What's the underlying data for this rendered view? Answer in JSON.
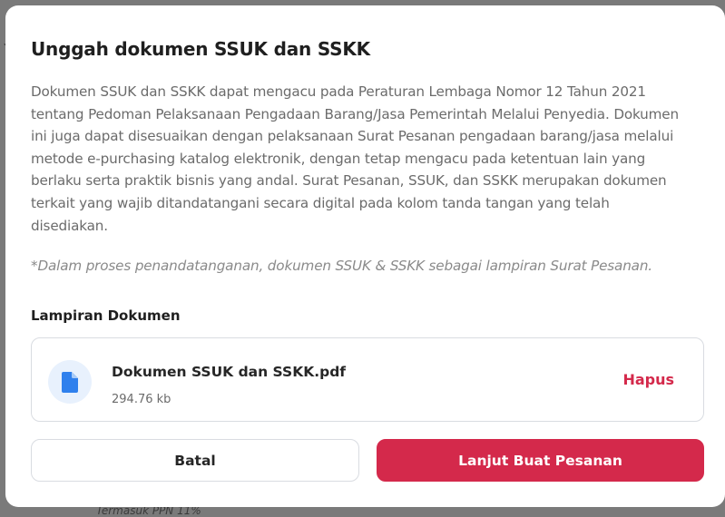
{
  "background": {
    "peek_text": "Termasuk PPN 11%",
    "overlay_color": "#7a7a7a"
  },
  "modal": {
    "title": "Unggah dokumen SSUK dan SSKK",
    "description": "Dokumen SSUK dan SSKK dapat mengacu pada Peraturan Lembaga Nomor 12 Tahun 2021 tentang Pedoman Pelaksanaan Pengadaan Barang/Jasa Pemerintah Melalui Penyedia. Dokumen ini juga dapat disesuaikan dengan pelaksanaan Surat Pesanan pengadaan barang/jasa melalui metode e-purchasing katalog elektronik, dengan tetap mengacu pada ketentuan lain yang berlaku serta praktik bisnis yang andal. Surat Pesanan, SSUK, dan SSKK merupakan dokumen terkait yang wajib ditandatangani secara digital pada kolom tanda tangan yang telah disediakan.",
    "note": "*Dalam proses penandatanganan, dokumen SSUK & SSKK sebagai lampiran Surat Pesanan.",
    "attachment": {
      "label": "Lampiran Dokumen",
      "file_name": "Dokumen SSUK dan SSKK.pdf",
      "file_size": "294.76 kb",
      "icon": "document-file-icon",
      "remove_label": "Hapus"
    },
    "buttons": {
      "cancel_label": "Batal",
      "confirm_label": "Lanjut Buat Pesanan"
    }
  },
  "colors": {
    "primary": "#d4294b",
    "file_icon": "#2f80ed",
    "file_icon_bg": "#e8f1fd",
    "text_dark": "#1f1f1f",
    "text_muted": "#6b6b6b",
    "border": "#d9dce1"
  }
}
